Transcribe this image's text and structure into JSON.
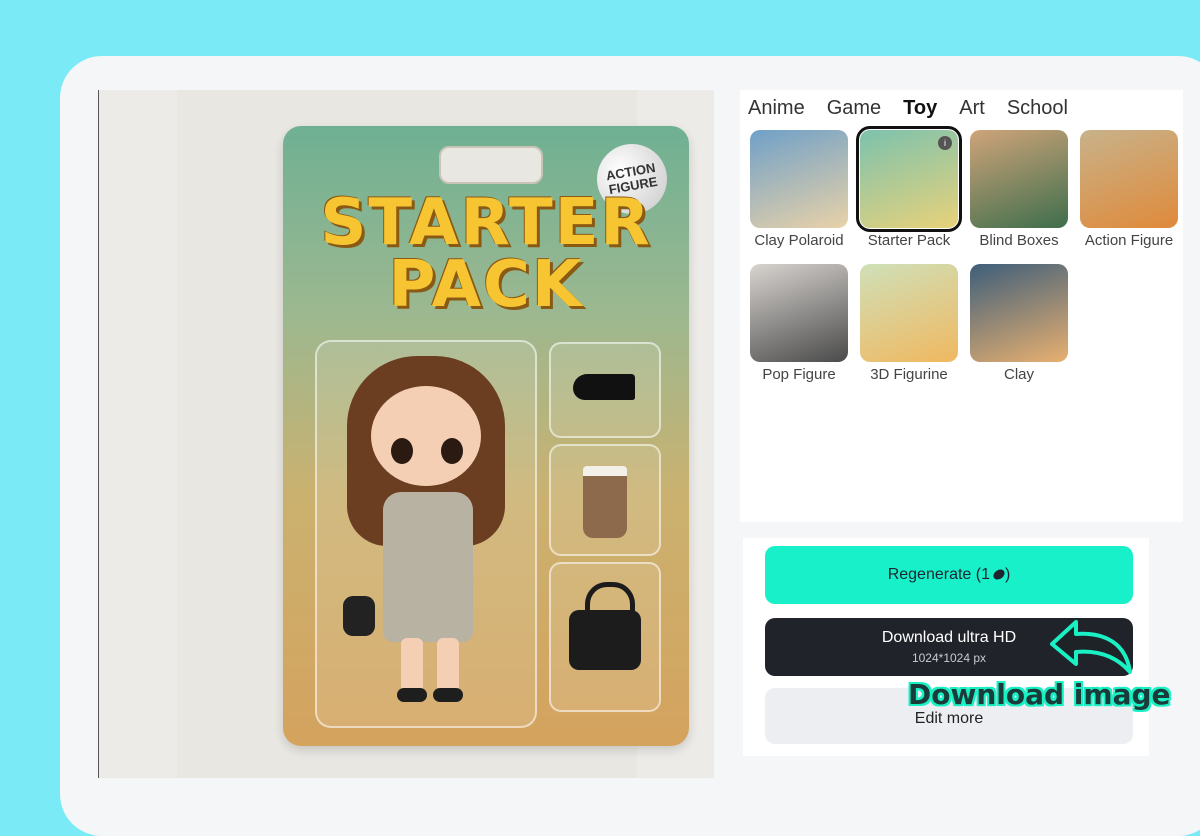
{
  "preview": {
    "card_badge": "ACTION\nFIGURE",
    "card_title": "STARTER\nPACK"
  },
  "styles": {
    "tabs": [
      {
        "label": "Anime",
        "active": false
      },
      {
        "label": "Game",
        "active": false
      },
      {
        "label": "Toy",
        "active": true
      },
      {
        "label": "Art",
        "active": false
      },
      {
        "label": "School",
        "active": false
      }
    ],
    "items": [
      {
        "label": "Clay Polaroid",
        "colors": [
          "#6fa0c8",
          "#e9d2a8"
        ]
      },
      {
        "label": "Starter Pack",
        "colors": [
          "#7cc2ae",
          "#e8d27a"
        ],
        "selected": true
      },
      {
        "label": "Blind Boxes",
        "colors": [
          "#cfa47a",
          "#3e6e4c"
        ]
      },
      {
        "label": "Action Figure",
        "colors": [
          "#c8b28a",
          "#e08a3a"
        ]
      },
      {
        "label": "Pop Figure",
        "colors": [
          "#d8d4d0",
          "#4a4a4a"
        ]
      },
      {
        "label": "3D Figurine",
        "colors": [
          "#cfe0b8",
          "#f0b860"
        ]
      },
      {
        "label": "Clay",
        "colors": [
          "#3e5e7a",
          "#e8b070"
        ]
      }
    ]
  },
  "actions": {
    "regenerate_label": "Regenerate (1",
    "regenerate_suffix": ")",
    "download_label": "Download ultra HD",
    "download_size": "1024*1024 px",
    "edit_label": "Edit more"
  },
  "annotation": {
    "text": "Download image"
  },
  "colors": {
    "background": "#79eaf6",
    "accent": "#17f0c8",
    "dark_button": "#20242a"
  }
}
